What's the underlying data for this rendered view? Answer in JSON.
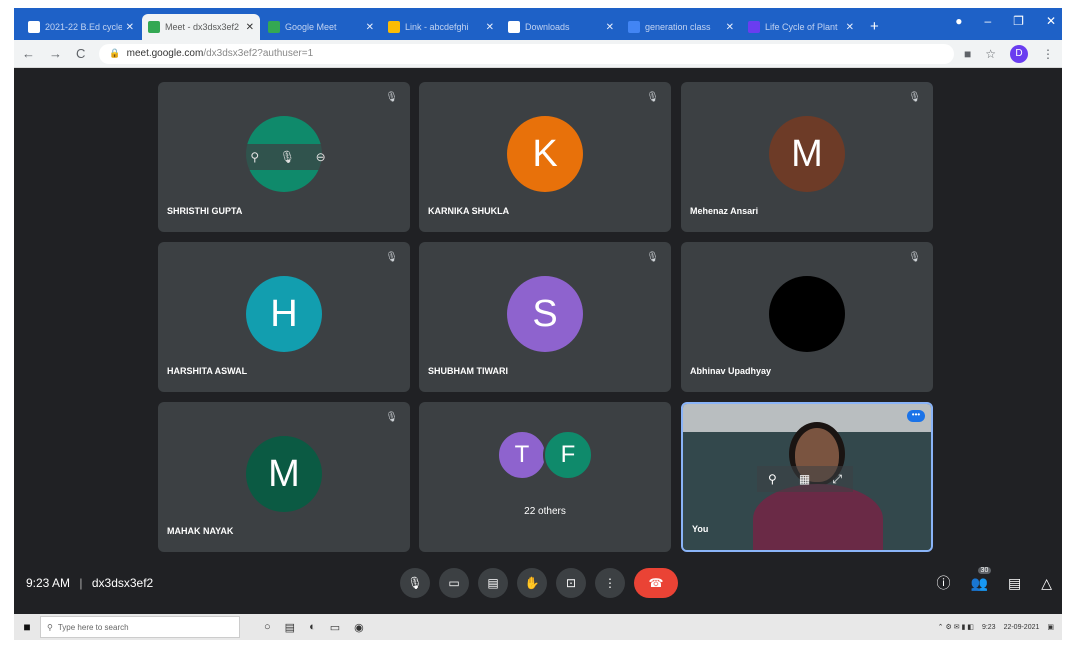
{
  "browser": {
    "tabs": [
      {
        "title": "2021-22 B.Ed cycle",
        "favicon_color": "#ffffff"
      },
      {
        "title": "Meet - dx3dsx3ef2",
        "favicon_color": "#34a853"
      },
      {
        "title": "Google Meet",
        "favicon_color": "#34a853"
      },
      {
        "title": "Link - abcdefghi",
        "favicon_color": "#fbbc04"
      },
      {
        "title": "Downloads",
        "favicon_color": "#ffffff"
      },
      {
        "title": "generation class",
        "favicon_color": "#4285f4"
      },
      {
        "title": "Life Cycle of Plant",
        "favicon_color": "#6a3df0"
      }
    ],
    "url_domain": "meet.google.com",
    "url_path": "/dx3dsx3ef2?authuser=1",
    "profile_initial": "D",
    "new_tab_label": "+",
    "window_controls": [
      "●",
      "–",
      "❐",
      "✕"
    ]
  },
  "meeting": {
    "participants": [
      {
        "name": "SHRISTHI GUPTA",
        "initial": "",
        "color": "#0f8a6b",
        "hovered": true
      },
      {
        "name": "KARNIKA SHUKLA",
        "initial": "K",
        "color": "#e8710a"
      },
      {
        "name": "Mehenaz Ansari",
        "initial": "M",
        "color": "#6d3b27"
      },
      {
        "name": "HARSHITA ASWAL",
        "initial": "H",
        "color": "#129eaf"
      },
      {
        "name": "SHUBHAM TIWARI",
        "initial": "S",
        "color": "#8e63ce"
      },
      {
        "name": "Abhinav Upadhyay",
        "initial": "",
        "color": "#000000"
      },
      {
        "name": "MAHAK NAYAK",
        "initial": "M",
        "color": "#0b5a43"
      }
    ],
    "others_tile": {
      "initials": [
        "T",
        "F"
      ],
      "colors": [
        "#8e63ce",
        "#0f8a6b"
      ],
      "label": "22 others"
    },
    "self_tile": {
      "name": "You"
    },
    "time": "9:23 AM",
    "separator": "|",
    "meeting_code": "dx3dsx3ef2",
    "participant_count": "30",
    "icons": {
      "mic": "🎙",
      "camera": "▭",
      "captions": "▤",
      "raise_hand": "✋",
      "present": "⊡",
      "more": "⋮",
      "end_call": "☎",
      "info": "ⓘ",
      "people": "👥",
      "chat": "▤",
      "activities": "△",
      "pin": "⚲",
      "mute_other": "🎙",
      "remove": "⊖",
      "muted_indicator": "🎙"
    }
  },
  "taskbar": {
    "search_placeholder": "Type here to search",
    "time": "9:23",
    "date": "22-09-2021"
  }
}
